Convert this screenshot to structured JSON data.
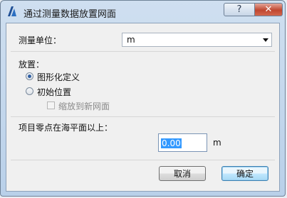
{
  "window": {
    "title": "通过测量数据放置网面",
    "help_label": "?",
    "close_label": "✕",
    "app_icon": "archicad-logo-icon"
  },
  "measure_unit": {
    "label": "测量单位：",
    "value": "m"
  },
  "placement": {
    "label": "放置：",
    "options": [
      {
        "label": "图形化定义",
        "selected": true
      },
      {
        "label": "初始位置",
        "selected": false
      }
    ],
    "zoom_checkbox": {
      "label": "缩放到新网面",
      "checked": false,
      "enabled": false
    }
  },
  "elevation": {
    "label": "项目零点在海平面以上：",
    "value": "0.00",
    "unit": "m"
  },
  "buttons": {
    "cancel": "取消",
    "ok": "确定"
  }
}
